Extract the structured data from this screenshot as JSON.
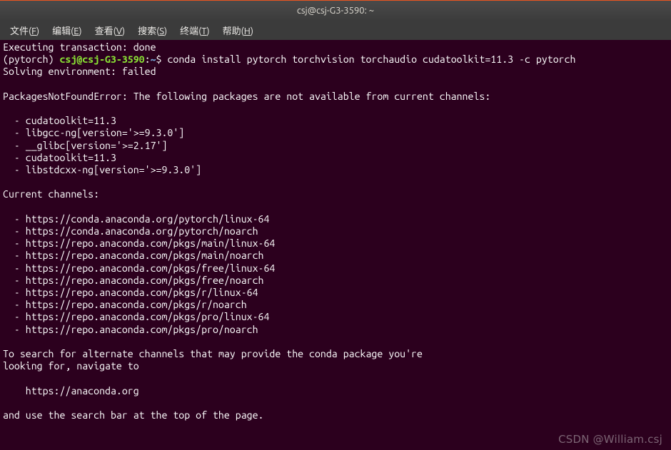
{
  "titlebar": {
    "title": "csj@csj-G3-3590: ~"
  },
  "menubar": {
    "items": [
      {
        "label": "文件",
        "accel": "F"
      },
      {
        "label": "编辑",
        "accel": "E"
      },
      {
        "label": "查看",
        "accel": "V"
      },
      {
        "label": "搜索",
        "accel": "S"
      },
      {
        "label": "终端",
        "accel": "T"
      },
      {
        "label": "帮助",
        "accel": "H"
      }
    ]
  },
  "terminal": {
    "line_executing": "Executing transaction: done",
    "prompt": {
      "env": "(pytorch) ",
      "userhost": "csj@csj-G3-3590",
      "sep": ":",
      "path": "~",
      "dollar": "$ ",
      "command": "conda install pytorch torchvision torchaudio cudatoolkit=11.3 -c pytorch"
    },
    "line_solving": "Solving environment: failed",
    "blank": "",
    "err_header": "PackagesNotFoundError: The following packages are not available from current channels:",
    "missing_packages": [
      "  - cudatoolkit=11.3",
      "  - libgcc-ng[version='>=9.3.0']",
      "  - __glibc[version='>=2.17']",
      "  - cudatoolkit=11.3",
      "  - libstdcxx-ng[version='>=9.3.0']"
    ],
    "channels_header": "Current channels:",
    "channels": [
      "  - https://conda.anaconda.org/pytorch/linux-64",
      "  - https://conda.anaconda.org/pytorch/noarch",
      "  - https://repo.anaconda.com/pkgs/main/linux-64",
      "  - https://repo.anaconda.com/pkgs/main/noarch",
      "  - https://repo.anaconda.com/pkgs/free/linux-64",
      "  - https://repo.anaconda.com/pkgs/free/noarch",
      "  - https://repo.anaconda.com/pkgs/r/linux-64",
      "  - https://repo.anaconda.com/pkgs/r/noarch",
      "  - https://repo.anaconda.com/pkgs/pro/linux-64",
      "  - https://repo.anaconda.com/pkgs/pro/noarch"
    ],
    "hint1": "To search for alternate channels that may provide the conda package you're",
    "hint2": "looking for, navigate to",
    "hint_url": "    https://anaconda.org",
    "hint3": "and use the search bar at the top of the page."
  },
  "watermark": "CSDN @William.csj"
}
